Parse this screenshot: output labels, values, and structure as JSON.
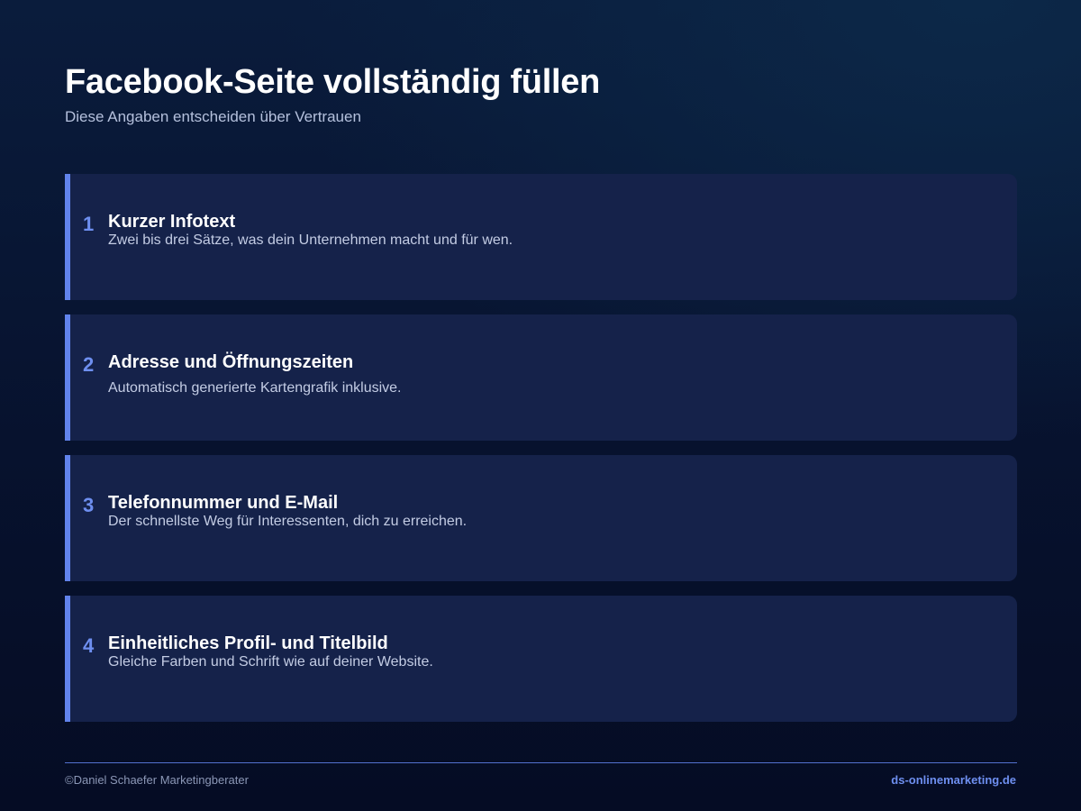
{
  "header": {
    "title": "Facebook-Seite vollständig füllen",
    "subtitle": "Diese Angaben entscheiden über Vertrauen"
  },
  "colors": {
    "accent": "#6183ec",
    "card_background": "#15224a",
    "page_background": "#07122e"
  },
  "cards": [
    {
      "number": "1",
      "title": "Kurzer Infotext",
      "description": "Zwei bis drei Sätze, was dein Unternehmen macht und für wen."
    },
    {
      "number": "2",
      "title": "Adresse und Öffnungszeiten",
      "description": "Automatisch generierte Kartengrafik inklusive."
    },
    {
      "number": "3",
      "title": "Telefonnummer und E-Mail",
      "description": "Der schnellste Weg für Interessenten, dich zu erreichen."
    },
    {
      "number": "4",
      "title": "Einheitliches Profil- und Titelbild",
      "description": "Gleiche Farben und Schrift wie auf deiner Website."
    }
  ],
  "footer": {
    "copyright": "©Daniel Schaefer Marketingberater",
    "website": "ds-onlinemarketing.de"
  }
}
